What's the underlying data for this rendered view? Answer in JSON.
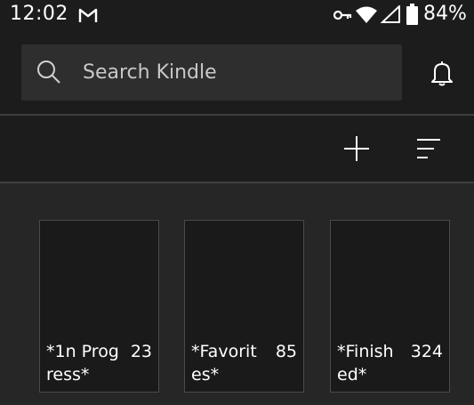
{
  "status_bar": {
    "time": "12:02",
    "battery": "84%",
    "icons": [
      "gmail-icon",
      "vpn-key-icon",
      "wifi-icon",
      "cell-signal-icon",
      "battery-icon"
    ]
  },
  "search": {
    "placeholder": "Search Kindle",
    "value": ""
  },
  "header_icons": [
    "search-icon",
    "bell-icon",
    "add-icon",
    "sort-filter-icon"
  ],
  "collections": [
    {
      "title": "*1n Prog\nress*",
      "count": "23"
    },
    {
      "title": "*Favorit\nes*",
      "count": "85"
    },
    {
      "title": "*Finish\ned*",
      "count": "324"
    }
  ],
  "colors": {
    "bar_background": "#1c1c1c",
    "page_background": "#262626",
    "search_background": "#2e2e2e",
    "tile_background": "#1a1a1a",
    "text": "#ffffff"
  }
}
